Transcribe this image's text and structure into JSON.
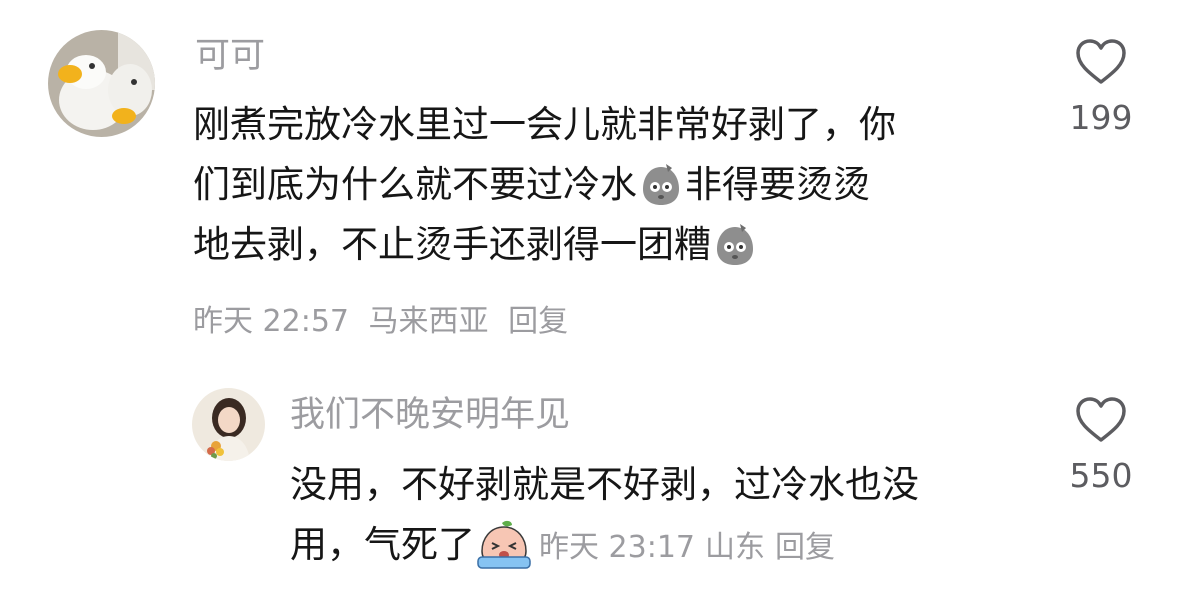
{
  "comments": [
    {
      "username": "可可",
      "content_lines": [
        "刚煮完放冷水里过一会儿就非常好剥了，你",
        "们到底为什么就不要过冷水",
        "非得要烫烫",
        "地去剥，不止烫手还剥得一团糟"
      ],
      "time": "昨天 22:57",
      "location": "马来西亚",
      "reply_label": "回复",
      "likes": "199",
      "emoji": "thinking-potato-emoji",
      "replies": [
        {
          "username": "我们不晚安明年见",
          "content_lines": [
            "没用，不好剥就是不好剥，过冷水也没",
            "用，气死了"
          ],
          "time": "昨天 23:17",
          "location": "山东",
          "reply_label": "回复",
          "likes": "550",
          "emoji": "crying-peach-emoji"
        }
      ]
    }
  ],
  "colors": {
    "username": "#9c9ca0",
    "text": "#161616",
    "meta": "#9c9ca0",
    "like_icon": "#5c5c60"
  }
}
